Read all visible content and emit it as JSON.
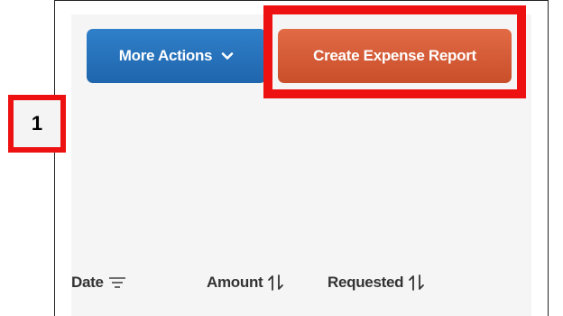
{
  "toolbar": {
    "more_actions_label": "More Actions",
    "create_report_label": "Create Expense Report"
  },
  "callout": {
    "step_number": "1"
  },
  "table": {
    "columns": [
      {
        "label": "Date",
        "icon": "filter-lines-icon"
      },
      {
        "label": "Amount",
        "icon": "sort-arrows-icon"
      },
      {
        "label": "Requested",
        "icon": "sort-arrows-icon"
      }
    ]
  },
  "colors": {
    "primary_button": "#1f66ad",
    "create_button": "#d85a35",
    "highlight": "#ee1111"
  }
}
